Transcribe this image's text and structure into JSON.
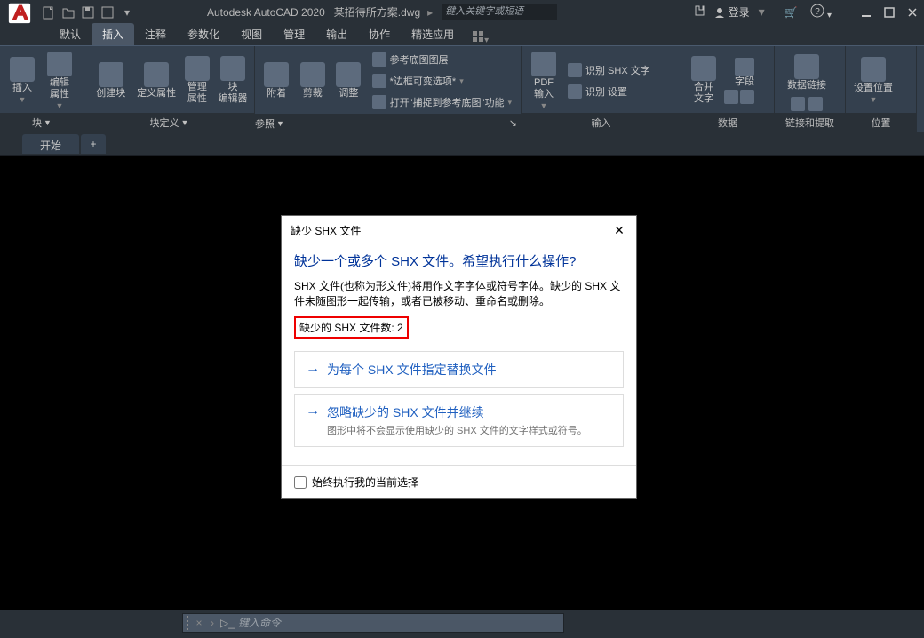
{
  "app": {
    "title": "Autodesk AutoCAD 2020",
    "document": "某招待所方案.dwg",
    "search_placeholder": "键入关键字或短语",
    "login": "登录"
  },
  "ribbon_tabs": [
    "默认",
    "插入",
    "注释",
    "参数化",
    "视图",
    "管理",
    "输出",
    "协作",
    "精选应用"
  ],
  "active_tab_index": 1,
  "panels": {
    "block": {
      "title": "块",
      "insert": "插入",
      "editattr": "编辑\n属性"
    },
    "blockdef": {
      "title": "块定义",
      "create": "创建块",
      "defattr": "定义属性",
      "mgrattr": "管理\n属性",
      "blockedit": "块\n编辑器"
    },
    "reference": {
      "title": "参照",
      "attach": "附着",
      "clip": "剪裁",
      "adjust": "调整",
      "row1": "参考底图图层",
      "row2": "*边框可变选项*",
      "row3": "打开\"捕捉到参考底图\"功能"
    },
    "import": {
      "title": "输入",
      "pdf": "PDF\n输入",
      "rec": "识别 SHX 文字",
      "set": "识别 设置"
    },
    "data": {
      "title": "数据",
      "merge": "合并\n文字",
      "field": "字段",
      "link": "数据链接"
    },
    "linkextract": {
      "title": "链接和提取"
    },
    "location": {
      "title": "位置",
      "btn": "设置位置"
    }
  },
  "doc_tabs": {
    "start": "开始",
    "plus": "+"
  },
  "dialog": {
    "title": "缺少 SHX 文件",
    "heading": "缺少一个或多个 SHX 文件。希望执行什么操作?",
    "body": "SHX 文件(也称为形文件)将用作文字字体或符号字体。缺少的 SHX 文件未随图形一起传输，或者已被移动、重命名或删除。",
    "count_label": "缺少的 SHX 文件数: 2",
    "option1": "为每个 SHX 文件指定替换文件",
    "option2": "忽略缺少的 SHX 文件并继续",
    "option2_desc": "图形中将不会显示使用缺少的 SHX 文件的文字样式或符号。",
    "always": "始终执行我的当前选择"
  },
  "cmdline": {
    "placeholder": "键入命令"
  }
}
